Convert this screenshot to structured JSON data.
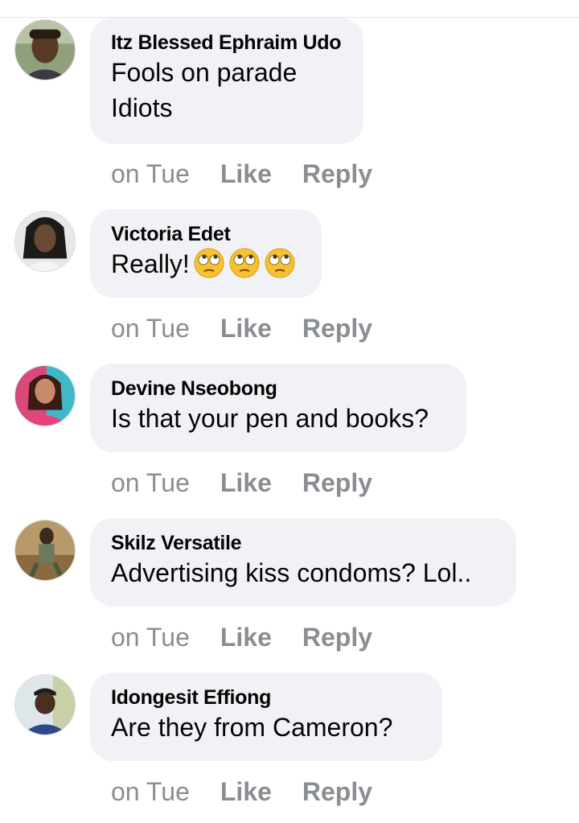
{
  "comments": [
    {
      "author": "Itz Blessed Ephraim Udo",
      "text": "Fools on parade\nIdiots",
      "time": "on Tue",
      "like_label": "Like",
      "reply_label": "Reply",
      "avatar": "person-photo"
    },
    {
      "author": "Victoria Edet",
      "text": "Really!",
      "emojis": [
        "eye-roll-emoji",
        "eye-roll-emoji",
        "eye-roll-emoji"
      ],
      "time": "on Tue",
      "like_label": "Like",
      "reply_label": "Reply",
      "avatar": "person-photo"
    },
    {
      "author": "Devine Nseobong",
      "text": "Is that your pen and books?",
      "time": "on Tue",
      "like_label": "Like",
      "reply_label": "Reply",
      "avatar": "person-photo"
    },
    {
      "author": "Skilz Versatile",
      "text": "Advertising kiss condoms? Lol..",
      "time": "on Tue",
      "like_label": "Like",
      "reply_label": "Reply",
      "avatar": "person-photo"
    },
    {
      "author": "Idongesit Effiong",
      "text": "Are they from Cameron?",
      "time": "on Tue",
      "like_label": "Like",
      "reply_label": "Reply",
      "avatar": "person-photo"
    }
  ],
  "colors": {
    "bubble": "#f0f2f5",
    "meta_text": "#8a8d91",
    "body_text": "#050505"
  }
}
